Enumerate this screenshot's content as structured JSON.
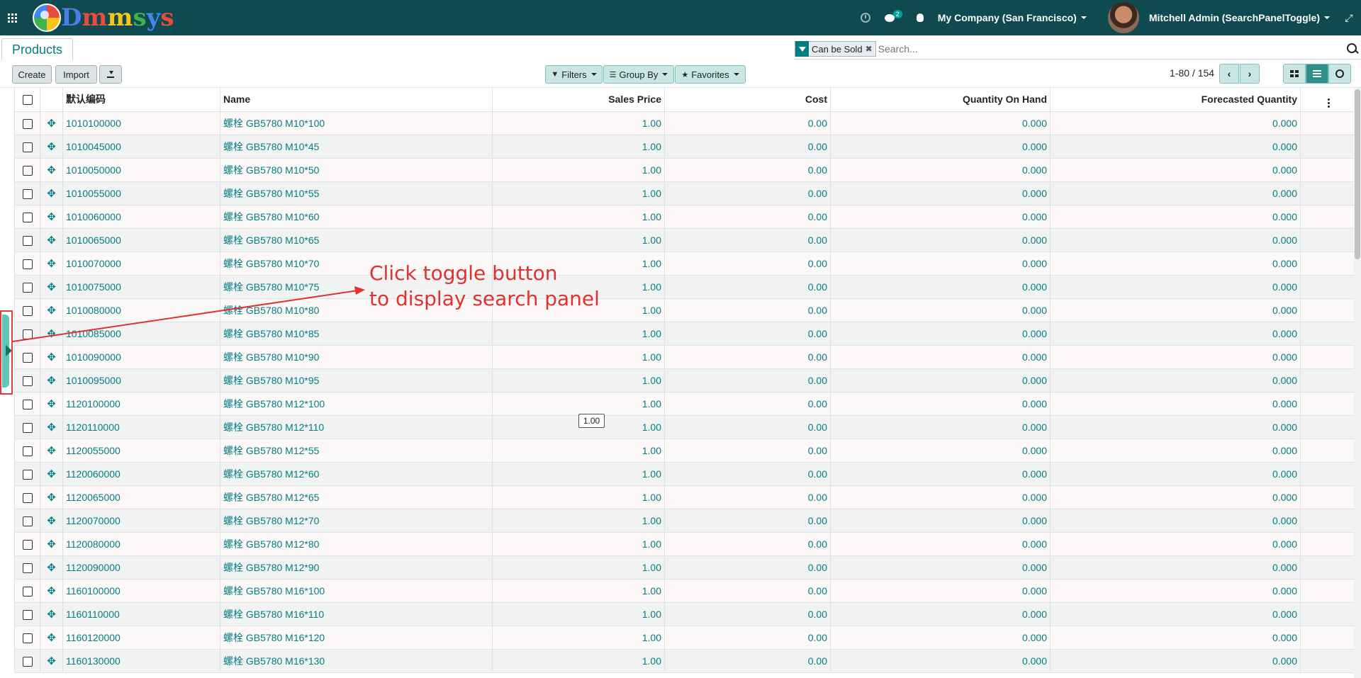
{
  "topbar": {
    "logo_text": "Dmmsys",
    "messages_badge": "2",
    "company": "My Company (San Francisco)",
    "user": "Mitchell Admin (SearchPanelToggle)"
  },
  "breadcrumb": "Products",
  "search": {
    "facet_label": "Can be Sold",
    "placeholder": "Search..."
  },
  "buttons": {
    "create": "Create",
    "import": "Import",
    "filters": "Filters",
    "group_by": "Group By",
    "favorites": "Favorites"
  },
  "pager": "1-80 / 154",
  "columns": [
    "默认编码",
    "Name",
    "Sales Price",
    "Cost",
    "Quantity On Hand",
    "Forecasted Quantity"
  ],
  "rows": [
    [
      "1010100000",
      "螺栓 GB5780 M10*100",
      "1.00",
      "0.00",
      "0.000",
      "0.000"
    ],
    [
      "1010045000",
      "螺栓 GB5780 M10*45",
      "1.00",
      "0.00",
      "0.000",
      "0.000"
    ],
    [
      "1010050000",
      "螺栓 GB5780 M10*50",
      "1.00",
      "0.00",
      "0.000",
      "0.000"
    ],
    [
      "1010055000",
      "螺栓 GB5780 M10*55",
      "1.00",
      "0.00",
      "0.000",
      "0.000"
    ],
    [
      "1010060000",
      "螺栓 GB5780 M10*60",
      "1.00",
      "0.00",
      "0.000",
      "0.000"
    ],
    [
      "1010065000",
      "螺栓 GB5780 M10*65",
      "1.00",
      "0.00",
      "0.000",
      "0.000"
    ],
    [
      "1010070000",
      "螺栓 GB5780 M10*70",
      "1.00",
      "0.00",
      "0.000",
      "0.000"
    ],
    [
      "1010075000",
      "螺栓 GB5780 M10*75",
      "1.00",
      "0.00",
      "0.000",
      "0.000"
    ],
    [
      "1010080000",
      "螺栓 GB5780 M10*80",
      "1.00",
      "0.00",
      "0.000",
      "0.000"
    ],
    [
      "1010085000",
      "螺栓 GB5780 M10*85",
      "1.00",
      "0.00",
      "0.000",
      "0.000"
    ],
    [
      "1010090000",
      "螺栓 GB5780 M10*90",
      "1.00",
      "0.00",
      "0.000",
      "0.000"
    ],
    [
      "1010095000",
      "螺栓 GB5780 M10*95",
      "1.00",
      "0.00",
      "0.000",
      "0.000"
    ],
    [
      "1120100000",
      "螺栓 GB5780 M12*100",
      "1.00",
      "0.00",
      "0.000",
      "0.000"
    ],
    [
      "1120110000",
      "螺栓 GB5780 M12*110",
      "1.00",
      "0.00",
      "0.000",
      "0.000"
    ],
    [
      "1120055000",
      "螺栓 GB5780 M12*55",
      "1.00",
      "0.00",
      "0.000",
      "0.000"
    ],
    [
      "1120060000",
      "螺栓 GB5780 M12*60",
      "1.00",
      "0.00",
      "0.000",
      "0.000"
    ],
    [
      "1120065000",
      "螺栓 GB5780 M12*65",
      "1.00",
      "0.00",
      "0.000",
      "0.000"
    ],
    [
      "1120070000",
      "螺栓 GB5780 M12*70",
      "1.00",
      "0.00",
      "0.000",
      "0.000"
    ],
    [
      "1120080000",
      "螺栓 GB5780 M12*80",
      "1.00",
      "0.00",
      "0.000",
      "0.000"
    ],
    [
      "1120090000",
      "螺栓 GB5780 M12*90",
      "1.00",
      "0.00",
      "0.000",
      "0.000"
    ],
    [
      "1160100000",
      "螺栓 GB5780 M16*100",
      "1.00",
      "0.00",
      "0.000",
      "0.000"
    ],
    [
      "1160110000",
      "螺栓 GB5780 M16*110",
      "1.00",
      "0.00",
      "0.000",
      "0.000"
    ],
    [
      "1160120000",
      "螺栓 GB5780 M16*120",
      "1.00",
      "0.00",
      "0.000",
      "0.000"
    ],
    [
      "1160130000",
      "螺栓 GB5780 M16*130",
      "1.00",
      "0.00",
      "0.000",
      "0.000"
    ]
  ],
  "annotation": {
    "line1": "Click toggle button",
    "line2": "to display search panel",
    "color": "#e03131"
  },
  "tooltip": "1.00",
  "colors": {
    "navbar": "#0e4a4f",
    "accent": "#017e84"
  }
}
